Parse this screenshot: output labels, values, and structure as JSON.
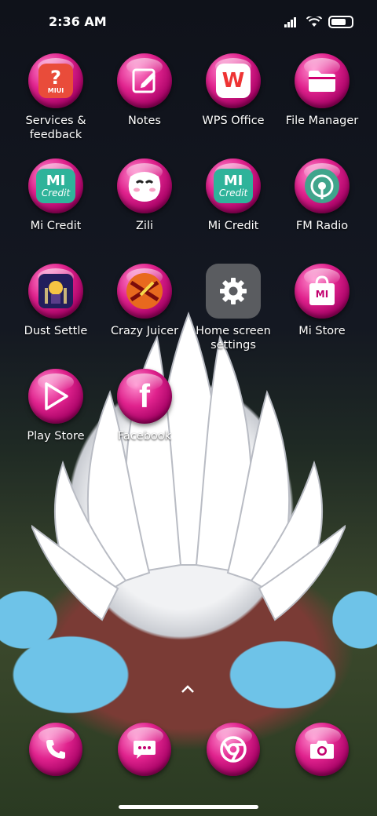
{
  "status_bar": {
    "time": "2:36 AM"
  },
  "apps": [
    {
      "label": "Services & feedback",
      "icon": "services-feedback-icon",
      "glyph": "?",
      "sub": "MIUI"
    },
    {
      "label": "Notes",
      "icon": "notes-icon"
    },
    {
      "label": "WPS Office",
      "icon": "wps-office-icon",
      "glyph": "W"
    },
    {
      "label": "File Manager",
      "icon": "folder-icon"
    },
    {
      "label": "Mi Credit",
      "icon": "mi-credit-icon",
      "glyph": "MI",
      "sub": "Credit"
    },
    {
      "label": "Zili",
      "icon": "zili-icon"
    },
    {
      "label": "Mi Credit",
      "icon": "mi-credit-icon",
      "glyph": "MI",
      "sub": "Credit"
    },
    {
      "label": "FM Radio",
      "icon": "radio-icon"
    },
    {
      "label": "Dust Settle",
      "icon": "dust-settle-icon"
    },
    {
      "label": "Crazy Juicer",
      "icon": "crazy-juicer-icon"
    },
    {
      "label": "Home screen settings",
      "icon": "gear-icon"
    },
    {
      "label": "Mi Store",
      "icon": "mi-store-icon",
      "glyph": "MI"
    },
    {
      "label": "Play Store",
      "icon": "play-store-icon"
    },
    {
      "label": "Facebook",
      "icon": "facebook-icon",
      "glyph": "f"
    }
  ],
  "dock": [
    {
      "icon": "phone-icon"
    },
    {
      "icon": "messages-icon"
    },
    {
      "icon": "chrome-icon"
    },
    {
      "icon": "camera-icon"
    }
  ],
  "colors": {
    "accent": "#e0228d",
    "settings_tile": "#5a5c60"
  }
}
